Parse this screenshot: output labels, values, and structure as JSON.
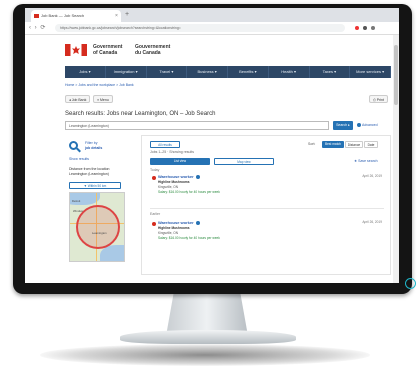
{
  "browser": {
    "tab_title": "Job Bank — Job Search",
    "new_tab_symbol": "+",
    "close_symbol": "×",
    "url": "https://www.jobbank.gc.ca/jobsearch/jobsearch?searchstring=&locationstring=",
    "nav_arrows": "‹ › ⟳"
  },
  "header": {
    "signature_en_line1": "Government",
    "signature_en_line2": "of Canada",
    "signature_fr_line1": "Gouvernement",
    "signature_fr_line2": "du Canada"
  },
  "menu": [
    "Jobs ▾",
    "Immigration ▾",
    "Travel ▾",
    "Business ▾",
    "Benefits ▾",
    "Health ▾",
    "Taxes ▾",
    "More services ▾"
  ],
  "breadcrumb": "Home > Jobs and the workplace > Job Bank",
  "toolbar": {
    "job_bank_label": "◂ Job Bank",
    "menu_label": "≡ Menu",
    "print_label": "⎙ Print"
  },
  "search": {
    "title": "Search results: Jobs near Leamington, ON – Job Search",
    "input_value": "Leamington (Leamington)",
    "button_label": "Search ▸",
    "advanced_label": "Advanced"
  },
  "sidebar": {
    "filter_title_line1": "Filter by",
    "filter_title_line2": "job details",
    "show_all": "Show results",
    "radius_line1": "Distance from the location",
    "radius_line2": "Leamington (Leamington)",
    "radius_button": "▼ Within 50 km",
    "map_city_1": "Windsor",
    "map_city_2": "Leamington",
    "map_city_3": "Detroit"
  },
  "results": {
    "sort_label": "Sort:",
    "sort_options": [
      "Best match",
      "Distance",
      "Date"
    ],
    "pill_label": "All results",
    "count_text": "Jobs 1–25 · Showing results",
    "tab_list": "List view",
    "tab_map": "Map view",
    "save_label": "★ Save search",
    "group_today": "Today",
    "group_earlier": "Earlier",
    "jobs": [
      {
        "title": "Warehouse worker",
        "employer": "Highline Mushrooms",
        "location": "Kingsville, ON",
        "salary": "Salary: $16.00 hourly for 40 hours per week",
        "date": "April 26, 2019"
      },
      {
        "title": "Warehouse worker",
        "employer": "Highline Mushrooms",
        "location": "Kingsville, ON",
        "salary": "Salary: $16.00 hourly for 40 hours per week",
        "date": "April 26, 2019"
      }
    ]
  },
  "colors": {
    "menu_bar": "#2d4766",
    "flag_red": "#d52b1e",
    "primary_blue": "#2572b4",
    "link_blue": "#2a5db0"
  }
}
